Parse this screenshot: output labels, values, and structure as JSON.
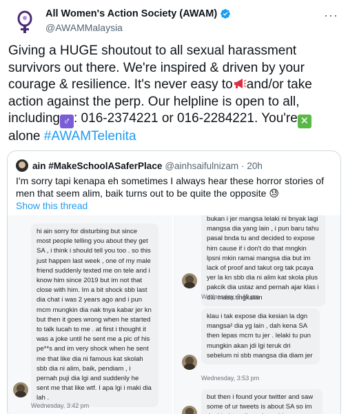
{
  "header": {
    "display_name": "All Women's Action Society (AWAM)",
    "handle": "@AWAMMalaysia",
    "more": "···"
  },
  "tweet": {
    "text_1": "Giving a HUGE shoutout to all sexual harassment survivors out there. We're inspired & driven by your courage & resilience. It's never easy to",
    "text_2": "and/or take action against the perp. Our helpline is open to all, including",
    "text_3": ": 016-2374221 or 016-2284221. You're",
    "text_4": "alone ",
    "hashtag": "#AWAMTelenita",
    "icons": [
      "megaphone-icon",
      "male-sign-icon",
      "cross-mark-icon"
    ]
  },
  "quote": {
    "name": "ain #MakeSchoolASaferPlace",
    "handle": "@ainhsaifulnizam",
    "time": "· 20h",
    "text": "I'm sorry tapi kenapa eh sometimes I always hear these horror stories of men that seem alim, baik turns out to be quite the opposite 😓",
    "show_thread": "Show this thread"
  },
  "screenshot_left": {
    "message": "hi ain sorry for disturbing but since most people telling you about they get SA , i think i should tell you too . so this just happen last week , one of my male friend suddenly texted me on tele and i know him since 2019 but im not that close with him. Im a bit shock sbb last dia chat i was 2 years ago and i pun mcm mungkin dia nak tnya kabar jer kn but then it goes wrong when he started to talk lucah to me . at first i thought it was a joke until he sent me a pic of his pe**s and im very shock when he sent me that like dia ni famous kat skolah sbb dia ni alim, baik, pendiam , i pernah puji dia lgi and suddenly he sent me that like wtf. I apa lgi i maki dia lah .",
    "timestamp": "Wednesday, 3:42 pm"
  },
  "screenshot_right": {
    "message_1": "bukan i jer mangsa lelaki ni bnyak lagi mangsa dia yang lain , i pun baru tahu pasal bnda tu and decided to expose him cause if i don't do that mngkin lpsni mkin ramai mangsa dia but im lack of proof and takut org tak pcaya yer la kn sbb dia ni alim kat skola plus pakcik dia ustaz and pernah ajar klas i dlu masa tingkatan",
    "timestamp_1": "Wednesday, 3:49 pm",
    "message_2": "klau i tak expose dia kesian la dgn mangsa² dia yg lain , dah kena SA then lepas mcm tu jer . lelaki tu pun mungkin akan jdi lgi teruk dri sebelum ni sbb mangsa dia diam jer",
    "timestamp_2": "Wednesday, 3:53 pm",
    "message_3": "but then i found your twitter and saw some of ur tweets is about SA so im decided to tell you bout this"
  }
}
